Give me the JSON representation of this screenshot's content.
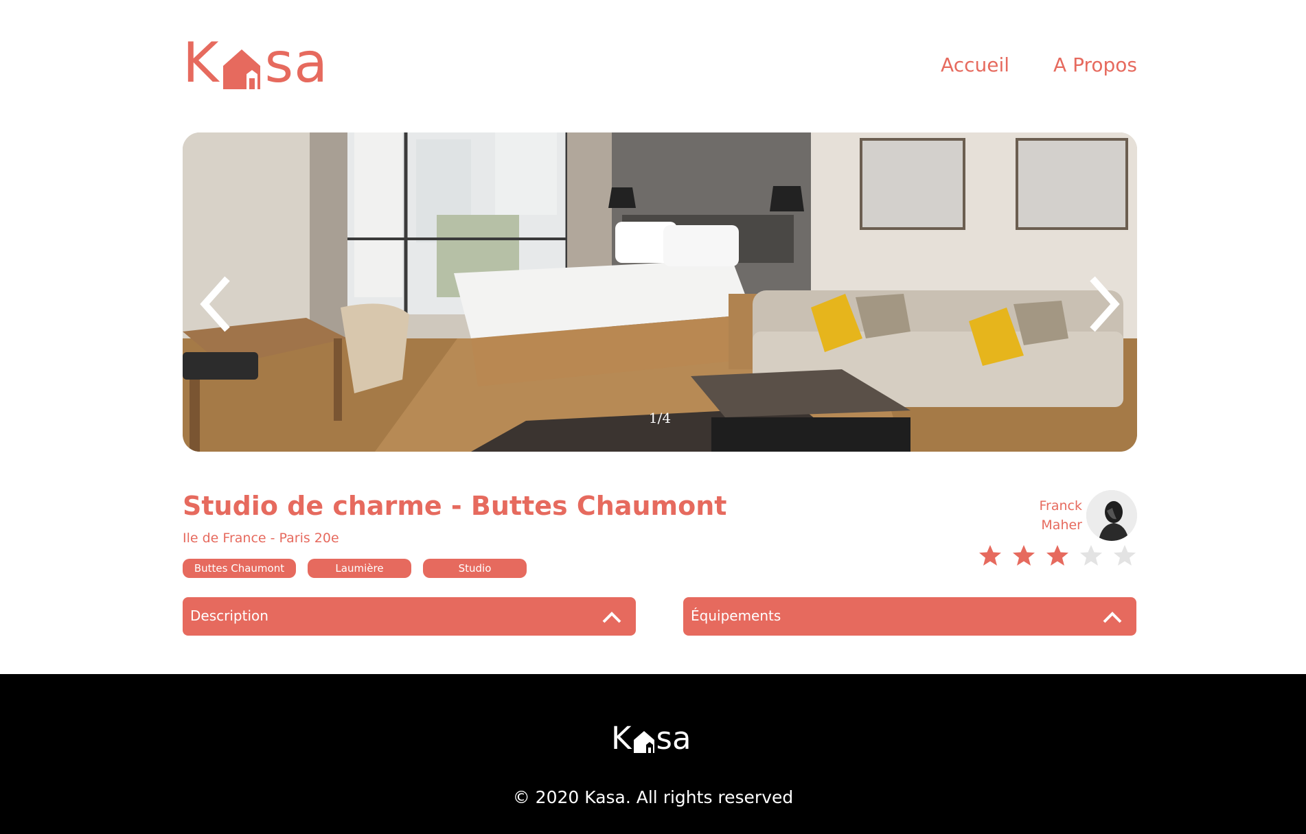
{
  "brand": {
    "logo_letters_left": "K",
    "logo_letters_right": "sa",
    "color": "#E66A5E"
  },
  "nav": {
    "items": [
      {
        "label": "Accueil"
      },
      {
        "label": "A Propos"
      }
    ]
  },
  "slideshow": {
    "counter": "1/4",
    "current": 1,
    "total": 4,
    "prev_icon": "chevron-left-icon",
    "next_icon": "chevron-right-icon"
  },
  "listing": {
    "title": "Studio de charme - Buttes Chaumont",
    "location": "Ile de France - Paris 20e",
    "tags": [
      "Buttes Chaumont",
      "Laumière",
      "Studio"
    ],
    "host": {
      "first_name": "Franck",
      "last_name": "Maher"
    },
    "rating": 3,
    "rating_max": 5,
    "star_active_color": "#E66A5E",
    "star_inactive_color": "#E3E3E3"
  },
  "collapses": [
    {
      "label": "Description",
      "icon": "chevron-up-icon"
    },
    {
      "label": "Équipements",
      "icon": "chevron-up-icon"
    }
  ],
  "footer": {
    "logo_letters_left": "K",
    "logo_letters_right": "sa",
    "copyright": "© 2020 Kasa. All rights reserved"
  }
}
